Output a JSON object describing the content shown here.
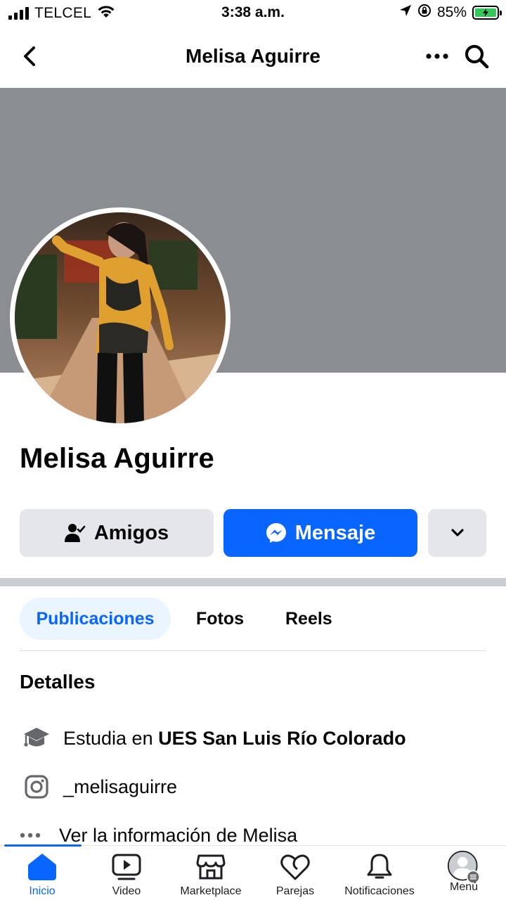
{
  "status_bar": {
    "carrier": "TELCEL",
    "time": "3:38 a.m.",
    "battery": "85%",
    "icons": [
      "signal-icon",
      "wifi-icon",
      "location-arrow-icon",
      "orientation-lock-icon",
      "battery-charging-icon"
    ]
  },
  "nav": {
    "title": "Melisa Aguirre",
    "icons": [
      "back-chevron-icon",
      "more-dots-icon",
      "search-icon"
    ]
  },
  "profile": {
    "name": "Melisa Aguirre",
    "avatar_icon": "profile-photo"
  },
  "actions": {
    "friends_label": "Amigos",
    "message_label": "Mensaje",
    "more_icon": "chevron-down-icon"
  },
  "tabs": [
    {
      "label": "Publicaciones",
      "active": true
    },
    {
      "label": "Fotos",
      "active": false
    },
    {
      "label": "Reels",
      "active": false
    }
  ],
  "details": {
    "title": "Detalles",
    "education_prefix": "Estudia en ",
    "education_school": "UES San Luis Río Colorado",
    "instagram": "_melisaguirre",
    "more_info": "Ver la información de Melisa"
  },
  "bottom_nav": {
    "items": [
      {
        "label": "Inicio",
        "icon": "home-icon",
        "active": true
      },
      {
        "label": "Video",
        "icon": "video-icon",
        "active": false
      },
      {
        "label": "Marketplace",
        "icon": "marketplace-icon",
        "active": false
      },
      {
        "label": "Parejas",
        "icon": "dating-heart-icon",
        "active": false
      },
      {
        "label": "Notificaciones",
        "icon": "bell-icon",
        "active": false
      },
      {
        "label": "Menú",
        "icon": "menu-avatar-icon",
        "active": false
      }
    ]
  },
  "colors": {
    "accent": "#0866ff",
    "button_gray": "#e4e6eb",
    "cover_gray": "#8a8d91",
    "tab_active_bg": "#ebf5ff"
  }
}
